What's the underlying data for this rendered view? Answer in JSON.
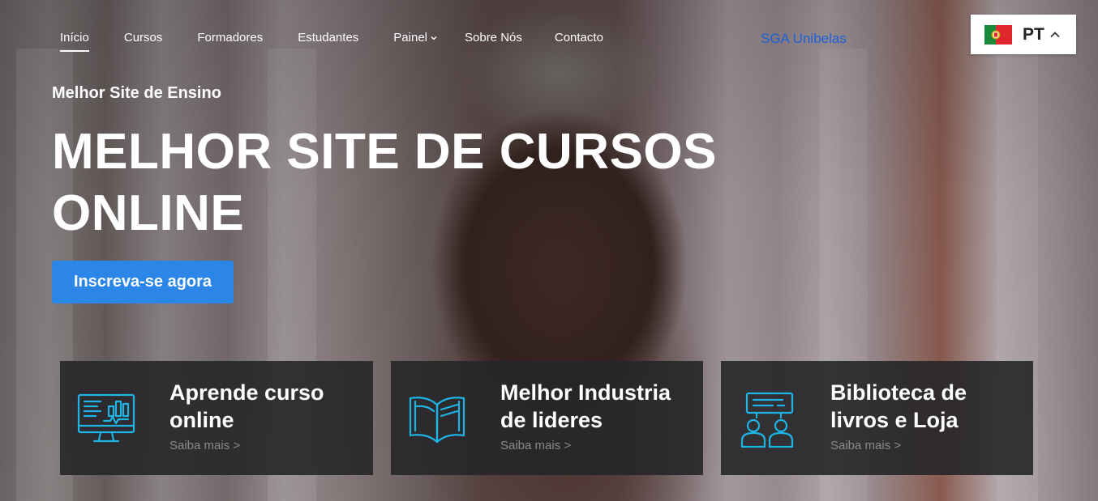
{
  "nav": {
    "items": [
      {
        "label": "Início",
        "active": true
      },
      {
        "label": "Cursos"
      },
      {
        "label": "Formadores"
      },
      {
        "label": "Estudantes"
      },
      {
        "label": "Painel",
        "has_dropdown": true
      },
      {
        "label": "Sobre Nós"
      },
      {
        "label": "Contacto"
      }
    ],
    "external_link": "SGA Unibelas"
  },
  "language": {
    "code": "PT",
    "flag_icon": "portugal-flag-icon"
  },
  "hero": {
    "eyebrow": "Melhor Site de Ensino",
    "headline": "MELHOR SITE DE CURSOS ONLINE",
    "cta_label": "Inscreva-se agora"
  },
  "features": [
    {
      "title": "Aprende curso online",
      "link": "Saiba mais >",
      "icon": "monitor-analytics-icon"
    },
    {
      "title": "Melhor Industria de lideres",
      "link": "Saiba mais >",
      "icon": "open-book-icon"
    },
    {
      "title": "Biblioteca de livros e Loja",
      "link": "Saiba mais >",
      "icon": "discussion-people-icon"
    }
  ],
  "colors": {
    "accent": "#2b86e8",
    "icon_cyan": "#1eb4e6",
    "link_blue": "#1f5fd6",
    "card_bg": "#262628"
  }
}
